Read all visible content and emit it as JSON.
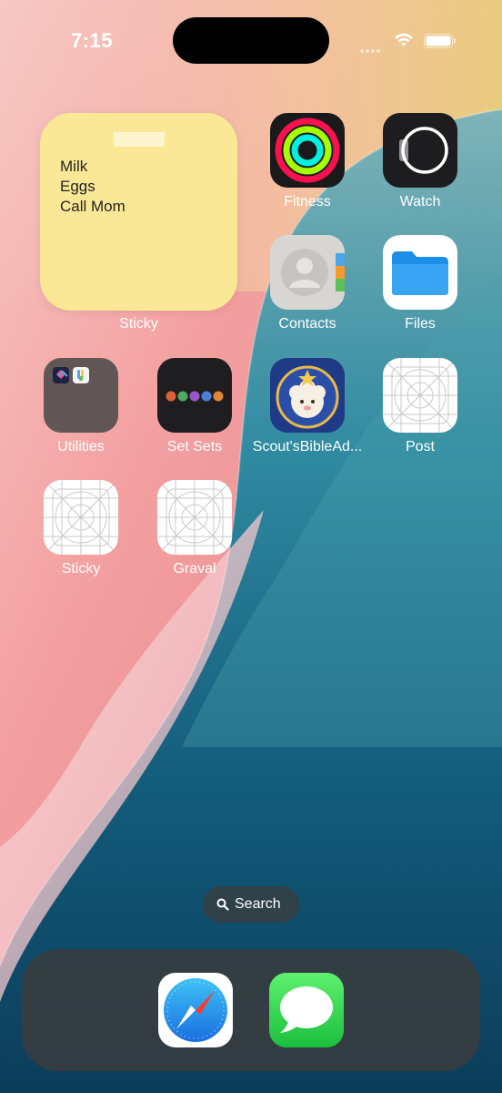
{
  "status_bar": {
    "time": "7:15",
    "icons": [
      "cellular-signal-icon",
      "wifi-icon",
      "battery-icon"
    ]
  },
  "widget": {
    "notes": [
      "Milk",
      "Eggs",
      "Call Mom"
    ],
    "label": "Sticky",
    "color": "#fbe896"
  },
  "apps": {
    "fitness": {
      "label": "Fitness",
      "icon": "fitness-rings-icon"
    },
    "watch": {
      "label": "Watch",
      "icon": "watch-icon"
    },
    "contacts": {
      "label": "Contacts",
      "icon": "contacts-icon"
    },
    "files": {
      "label": "Files",
      "icon": "folder-icon"
    },
    "utilities": {
      "label": "Utilities",
      "icon": "utilities-folder-icon"
    },
    "set_sets": {
      "label": "Set Sets",
      "icon": "colored-dots-icon"
    },
    "scout": {
      "label": "Scout'sBibleAd...",
      "icon": "lamb-icon"
    },
    "post": {
      "label": "Post",
      "icon": "placeholder-grid-icon"
    },
    "sticky": {
      "label": "Sticky",
      "icon": "placeholder-grid-icon"
    },
    "graval": {
      "label": "Graval",
      "icon": "placeholder-grid-icon"
    }
  },
  "search": {
    "label": "Search"
  },
  "dock": {
    "apps": [
      {
        "name": "Safari",
        "icon": "compass-icon"
      },
      {
        "name": "Messages",
        "icon": "speech-bubble-icon"
      }
    ]
  }
}
